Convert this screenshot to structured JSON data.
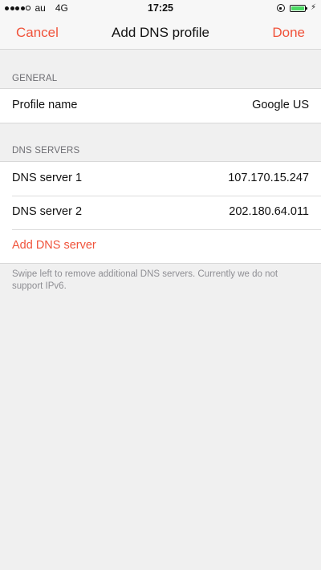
{
  "status_bar": {
    "carrier": "au",
    "network": "4G",
    "time": "17:25"
  },
  "nav": {
    "cancel_label": "Cancel",
    "title": "Add DNS profile",
    "done_label": "Done"
  },
  "general": {
    "header": "GENERAL",
    "profile_name_label": "Profile name",
    "profile_name_value": "Google US"
  },
  "dns_servers": {
    "header": "DNS SERVERS",
    "servers": [
      {
        "label": "DNS server 1",
        "value": "107.170.15.247"
      },
      {
        "label": "DNS server 2",
        "value": "202.180.64.011"
      }
    ],
    "add_label": "Add DNS server",
    "footer": "Swipe left to remove additional DNS servers. Currently we do not support IPv6."
  },
  "colors": {
    "accent": "#f0533b",
    "background": "#f0f0f0",
    "battery": "#4cd964"
  }
}
